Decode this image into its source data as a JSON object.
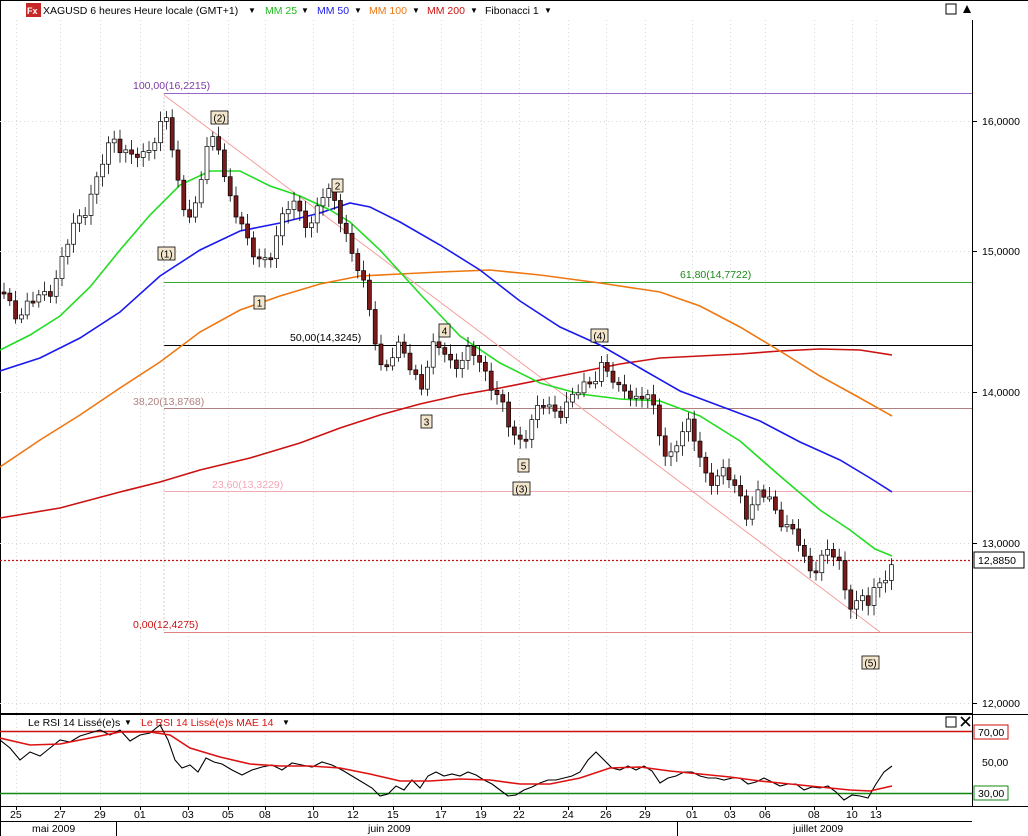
{
  "header": {
    "icon_label": "Fx",
    "symbol": "XAGUSD 6 heures Heure locale (GMT+1)",
    "indicators": [
      {
        "label": "MM 25",
        "color": "#22cc22"
      },
      {
        "label": "MM 50",
        "color": "#1a1aee"
      },
      {
        "label": "MM 100",
        "color": "#ee7711"
      },
      {
        "label": "MM 200",
        "color": "#cc1111"
      },
      {
        "label": "Fibonacci 1",
        "color": "#000000"
      }
    ],
    "dropdown_glyph": "▼",
    "maximize_glyph": "□",
    "scroll_glyph": "▲"
  },
  "rsi_header": {
    "label1": "Le RSI 14 Lissé(e)s",
    "label2": "Le RSI 14 Lissé(e)s MAE 14",
    "label2_color": "#dd1111",
    "close_glyph": "✕"
  },
  "price_axis": {
    "ticks": [
      "16,0000",
      "15,0000",
      "14,0000",
      "13,0000",
      "12,0000"
    ],
    "current_price": "12,8850"
  },
  "rsi_axis": {
    "ticks": [
      "70,00",
      "50,00",
      "30,00"
    ]
  },
  "fibonacci": [
    {
      "label": "100,00(16,2215)",
      "color": "#7a3aa8"
    },
    {
      "label": "61,80(14,7722)",
      "color": "#1a8a1a"
    },
    {
      "label": "50,00(14,3245)",
      "color": "#000000"
    },
    {
      "label": "38,20(13,8768)",
      "color": "#b08080"
    },
    {
      "label": "23,60(13,3229)",
      "color": "#f4a8b8"
    },
    {
      "label": "0,00(12,4275)",
      "color": "#cc1111"
    }
  ],
  "waves": [
    "(1)",
    "(2)",
    "1",
    "2",
    "3",
    "4",
    "5",
    "(3)",
    "(4)",
    "(5)"
  ],
  "date_axis": {
    "days": [
      "25",
      "27",
      "29",
      "01",
      "03",
      "05",
      "08",
      "10",
      "12",
      "15",
      "17",
      "19",
      "22",
      "24",
      "26",
      "29",
      "01",
      "03",
      "06",
      "08",
      "10",
      "13"
    ],
    "months": [
      "mai 2009",
      "juin 2009",
      "juillet 2009"
    ]
  },
  "colors": {
    "candle_up": "#ffffff",
    "candle_down": "#7a1a1a",
    "fib_channel": "#f0a0a0",
    "current_price_line": "#cc1111"
  }
}
